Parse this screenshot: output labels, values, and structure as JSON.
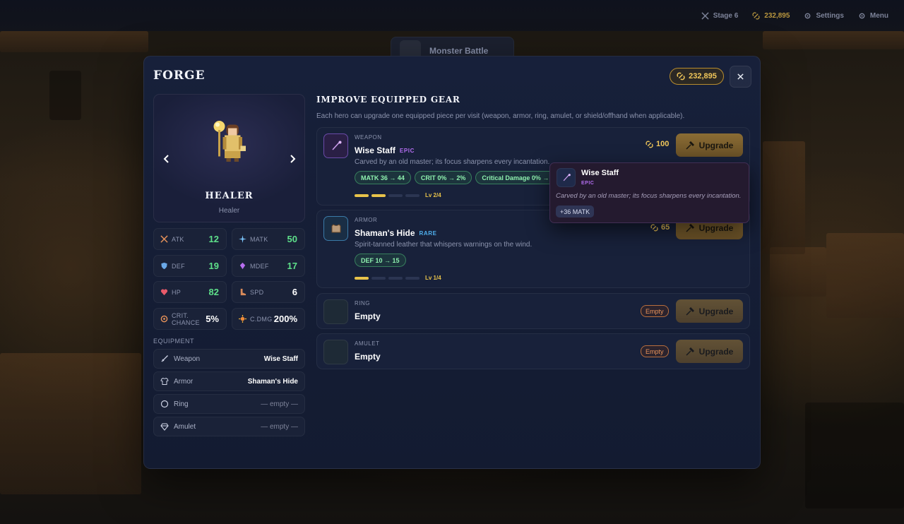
{
  "topbar": {
    "stage": "Stage 6",
    "gold": "232,895",
    "settings": "Settings",
    "menu": "Menu"
  },
  "background": {
    "panel_title": "Monster Battle"
  },
  "modal": {
    "title": "FORGE",
    "gold": "232,895"
  },
  "hero": {
    "name": "HEALER",
    "class": "Healer"
  },
  "stats": {
    "atk": {
      "label": "ATK",
      "value": "12"
    },
    "matk": {
      "label": "MATK",
      "value": "50"
    },
    "def": {
      "label": "DEF",
      "value": "19"
    },
    "mdef": {
      "label": "MDEF",
      "value": "17"
    },
    "hp": {
      "label": "HP",
      "value": "82"
    },
    "spd": {
      "label": "SPD",
      "value": "6"
    },
    "crit": {
      "label": "CRIT. CHANCE",
      "value": "5%"
    },
    "cdmg": {
      "label": "C.DMG",
      "value": "200%"
    }
  },
  "equipment": {
    "heading": "EQUIPMENT",
    "weapon": {
      "label": "Weapon",
      "value": "Wise Staff"
    },
    "armor": {
      "label": "Armor",
      "value": "Shaman's Hide"
    },
    "ring": {
      "label": "Ring",
      "value": "— empty —"
    },
    "amulet": {
      "label": "Amulet",
      "value": "— empty —"
    }
  },
  "gear_section": {
    "title": "IMPROVE EQUIPPED GEAR",
    "desc": "Each hero can upgrade one equipped piece per visit (weapon, armor, ring, amulet, or shield/offhand when applicable).",
    "items": [
      {
        "slot": "WEAPON",
        "name": "Wise Staff",
        "rarity": "EPIC",
        "desc": "Carved by an old master; its focus sharpens every incantation.",
        "chips": [
          "MATK 36 → 44",
          "CRIT 0% → 2%",
          "Critical Damage 0% → 5"
        ],
        "level": "Lv 2/4",
        "level_current": 2,
        "level_max": 4,
        "cost": "100",
        "button": "Upgrade"
      },
      {
        "slot": "ARMOR",
        "name": "Shaman's Hide",
        "rarity": "RARE",
        "desc": "Spirit-tanned leather that whispers warnings on the wind.",
        "chips": [
          "DEF 10 → 15"
        ],
        "level": "Lv 1/4",
        "level_current": 1,
        "level_max": 4,
        "cost": "65",
        "button": "Upgrade"
      },
      {
        "slot": "RING",
        "name": "Empty",
        "badge": "Empty",
        "button": "Upgrade"
      },
      {
        "slot": "AMULET",
        "name": "Empty",
        "badge": "Empty",
        "button": "Upgrade"
      }
    ]
  },
  "tooltip": {
    "name": "Wise Staff",
    "rarity": "EPIC",
    "desc": "Carved by an old master; its focus sharpens every incantation.",
    "stat": "+36 MATK"
  },
  "colors": {
    "gold": "#f1c75a",
    "epic": "#b36ef0",
    "rare": "#4fb0ee",
    "stat_green": "#5ee08a",
    "panel": "#17203a"
  }
}
